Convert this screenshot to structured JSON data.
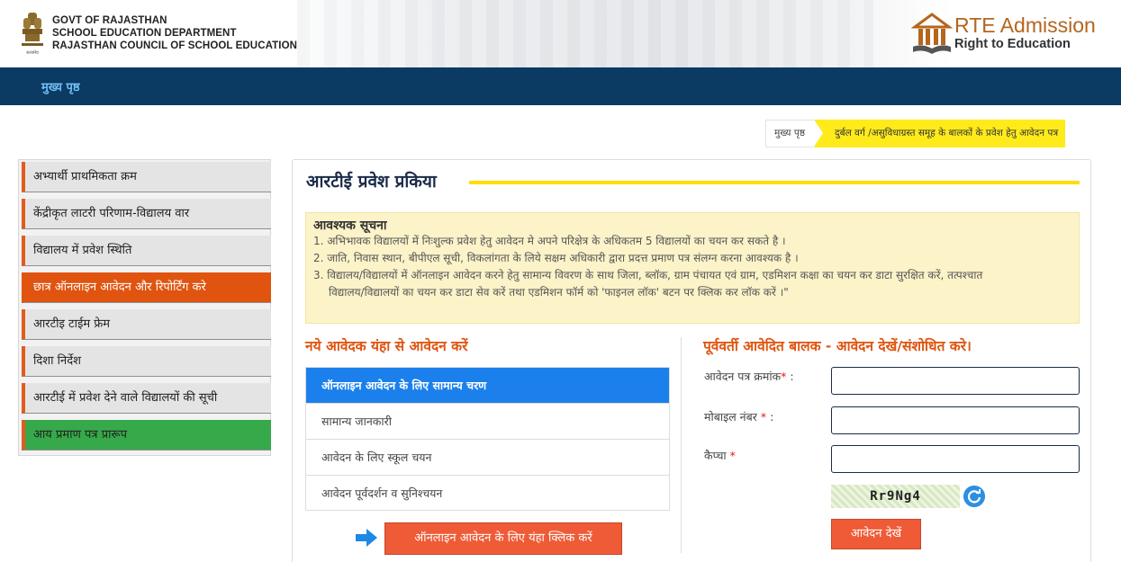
{
  "header": {
    "gov_lines": [
      "GOVT OF RAJASTHAN",
      "SCHOOL EDUCATION DEPARTMENT",
      "RAJASTHAN COUNCIL OF SCHOOL EDUCATION"
    ],
    "rte_title": "RTE Admission",
    "rte_subtitle": "Right to Education",
    "emblem_icon": "state-emblem-icon",
    "rte_logo_icon": "school-building-book-icon"
  },
  "nav": {
    "home_label": "मुख्य पृष्ठ"
  },
  "breadcrumb": {
    "home": "मुख्य पृष्ठ",
    "current": "दुर्बल वर्ग /असुविधाग्रस्त समूह के बालकों के प्रवेश हेतु आवेदन पत्र"
  },
  "sidebar": {
    "items": [
      {
        "label": "अभ्यार्थी प्राथमिकता क्रम"
      },
      {
        "label": "केंद्रीकृत लाटरी परिणाम-विद्यालय वार"
      },
      {
        "label": "विद्यालय में प्रवेश स्थिति"
      },
      {
        "label": "छात्र ऑनलाइन आवेदन और रिपोर्टिंग करे"
      },
      {
        "label": "आरटीइ टाईम फ्रेम"
      },
      {
        "label": "दिशा निर्देश"
      },
      {
        "label": "आरटीई में प्रवेश देने वाले विद्यालयों की सूची"
      },
      {
        "label": "आय प्रमाण पत्र प्रारूप"
      }
    ]
  },
  "main": {
    "title": "आरटीई प्रवेश प्रकिया",
    "notice": {
      "heading": "आवश्यक सूचना",
      "line1": "1. अभिभावक विद्यालयों में निःशुल्क प्रवेश हेतु आवेदन मे अपने परिक्षेत्र के अधिकतम 5 विद्यालयों का चयन कर सकते है ।",
      "line2": "2. जाति, निवास स्थान, बीपीएल सूची, विकलांगता के लिये सक्षम अधिकारी द्वारा प्रदत्त प्रमाण पत्र संलग्न करना आवश्यक है ।",
      "line3a": "3. विद्यालय/विद्यालयों में ऑनलाइन आवेदन करने हेतु सामान्य विवरण के साथ जिला, ब्लॉक, ग्राम पंचायत एवं ग्राम, एडमिशन कक्षा का चयन कर डाटा सुरक्षित करें, तत्पश्चात",
      "line3b": "विद्यालय/विद्यालयों का चयन कर डाटा सेव करें तथा एडमिशन फॉर्म को 'फाइनल लॉक' बटन पर क्लिक कर लॉक करें ।\""
    },
    "new_applicant": {
      "title": "नये आवेदक यंहा से आवेदन करें",
      "steps_header": "ऑनलाइन आवेदन के लिए सामान्य चरण",
      "steps": [
        "सामान्य जानकारी",
        "आवेदन के लिए स्कूल चयन",
        "आवेदन पूर्वदर्शन व सुनिश्चयन"
      ],
      "apply_button": "ऑनलाइन आवेदन के लिए यंहा क्लिक करें"
    },
    "existing": {
      "title": "पूर्ववर्ती आवेदित बालक - आवेदन देखें/संशोधित करे।",
      "form_no_label": "आवेदन पत्र क्रमांक",
      "mobile_label": "मोबाइल नंबर",
      "captcha_label": "कैप्चा",
      "required_mark": "*",
      "colon": ":",
      "captcha_text": "Rr9Ng4",
      "view_button": "आवेदन देखें"
    }
  }
}
